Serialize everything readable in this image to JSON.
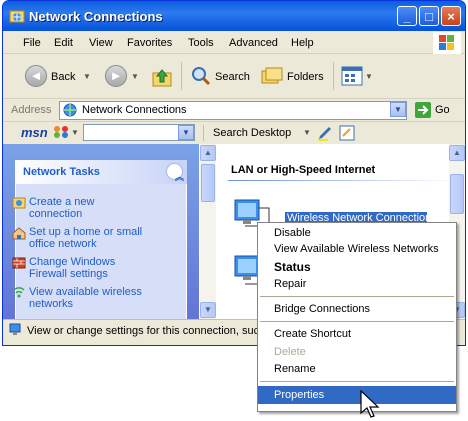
{
  "window": {
    "title": "Network Connections"
  },
  "menu": [
    "File",
    "Edit",
    "View",
    "Favorites",
    "Tools",
    "Advanced",
    "Help"
  ],
  "toolbar": {
    "back": "Back",
    "search": "Search",
    "folders": "Folders"
  },
  "address": {
    "label": "Address",
    "value": "Network Connections",
    "go": "Go"
  },
  "msn": {
    "logo": "msn",
    "search": "Search Desktop"
  },
  "tasks": {
    "title": "Network Tasks",
    "items": [
      "Create a new connection",
      "Set up a home or small office network",
      "Change Windows Firewall settings",
      "View available wireless networks"
    ]
  },
  "group": {
    "title": "LAN or High-Speed Internet",
    "connection": "Wireless Network Connection"
  },
  "status": {
    "text": "View or change settings for this connection, such"
  },
  "context_menu": {
    "items": [
      "Disable",
      "View Available Wireless Networks",
      "Status",
      "Repair",
      "Bridge Connections",
      "Create Shortcut",
      "Delete",
      "Rename",
      "Properties"
    ]
  },
  "colors": {
    "titlebar": "#0a5fdc",
    "selection": "#316ac5",
    "link": "#215dc6",
    "taskpane": "#7ba2e7"
  }
}
